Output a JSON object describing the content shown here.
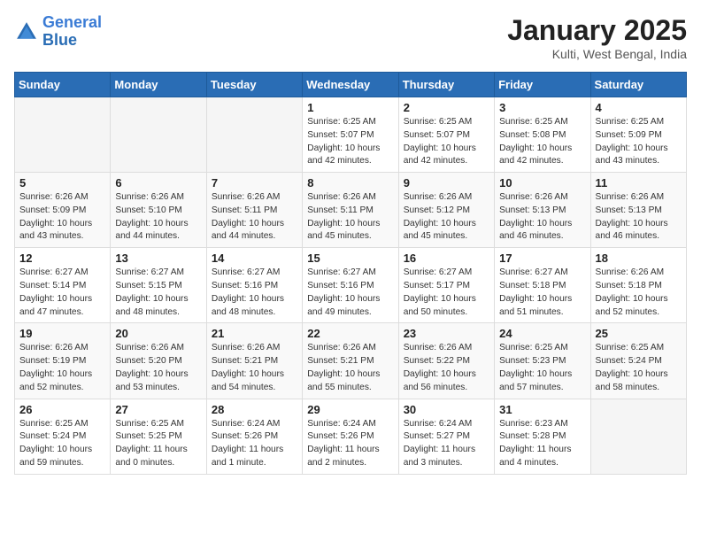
{
  "logo": {
    "line1": "General",
    "line2": "Blue"
  },
  "header": {
    "month": "January 2025",
    "location": "Kulti, West Bengal, India"
  },
  "weekdays": [
    "Sunday",
    "Monday",
    "Tuesday",
    "Wednesday",
    "Thursday",
    "Friday",
    "Saturday"
  ],
  "weeks": [
    [
      {
        "day": "",
        "detail": ""
      },
      {
        "day": "",
        "detail": ""
      },
      {
        "day": "",
        "detail": ""
      },
      {
        "day": "1",
        "detail": "Sunrise: 6:25 AM\nSunset: 5:07 PM\nDaylight: 10 hours\nand 42 minutes."
      },
      {
        "day": "2",
        "detail": "Sunrise: 6:25 AM\nSunset: 5:07 PM\nDaylight: 10 hours\nand 42 minutes."
      },
      {
        "day": "3",
        "detail": "Sunrise: 6:25 AM\nSunset: 5:08 PM\nDaylight: 10 hours\nand 42 minutes."
      },
      {
        "day": "4",
        "detail": "Sunrise: 6:25 AM\nSunset: 5:09 PM\nDaylight: 10 hours\nand 43 minutes."
      }
    ],
    [
      {
        "day": "5",
        "detail": "Sunrise: 6:26 AM\nSunset: 5:09 PM\nDaylight: 10 hours\nand 43 minutes."
      },
      {
        "day": "6",
        "detail": "Sunrise: 6:26 AM\nSunset: 5:10 PM\nDaylight: 10 hours\nand 44 minutes."
      },
      {
        "day": "7",
        "detail": "Sunrise: 6:26 AM\nSunset: 5:11 PM\nDaylight: 10 hours\nand 44 minutes."
      },
      {
        "day": "8",
        "detail": "Sunrise: 6:26 AM\nSunset: 5:11 PM\nDaylight: 10 hours\nand 45 minutes."
      },
      {
        "day": "9",
        "detail": "Sunrise: 6:26 AM\nSunset: 5:12 PM\nDaylight: 10 hours\nand 45 minutes."
      },
      {
        "day": "10",
        "detail": "Sunrise: 6:26 AM\nSunset: 5:13 PM\nDaylight: 10 hours\nand 46 minutes."
      },
      {
        "day": "11",
        "detail": "Sunrise: 6:26 AM\nSunset: 5:13 PM\nDaylight: 10 hours\nand 46 minutes."
      }
    ],
    [
      {
        "day": "12",
        "detail": "Sunrise: 6:27 AM\nSunset: 5:14 PM\nDaylight: 10 hours\nand 47 minutes."
      },
      {
        "day": "13",
        "detail": "Sunrise: 6:27 AM\nSunset: 5:15 PM\nDaylight: 10 hours\nand 48 minutes."
      },
      {
        "day": "14",
        "detail": "Sunrise: 6:27 AM\nSunset: 5:16 PM\nDaylight: 10 hours\nand 48 minutes."
      },
      {
        "day": "15",
        "detail": "Sunrise: 6:27 AM\nSunset: 5:16 PM\nDaylight: 10 hours\nand 49 minutes."
      },
      {
        "day": "16",
        "detail": "Sunrise: 6:27 AM\nSunset: 5:17 PM\nDaylight: 10 hours\nand 50 minutes."
      },
      {
        "day": "17",
        "detail": "Sunrise: 6:27 AM\nSunset: 5:18 PM\nDaylight: 10 hours\nand 51 minutes."
      },
      {
        "day": "18",
        "detail": "Sunrise: 6:26 AM\nSunset: 5:18 PM\nDaylight: 10 hours\nand 52 minutes."
      }
    ],
    [
      {
        "day": "19",
        "detail": "Sunrise: 6:26 AM\nSunset: 5:19 PM\nDaylight: 10 hours\nand 52 minutes."
      },
      {
        "day": "20",
        "detail": "Sunrise: 6:26 AM\nSunset: 5:20 PM\nDaylight: 10 hours\nand 53 minutes."
      },
      {
        "day": "21",
        "detail": "Sunrise: 6:26 AM\nSunset: 5:21 PM\nDaylight: 10 hours\nand 54 minutes."
      },
      {
        "day": "22",
        "detail": "Sunrise: 6:26 AM\nSunset: 5:21 PM\nDaylight: 10 hours\nand 55 minutes."
      },
      {
        "day": "23",
        "detail": "Sunrise: 6:26 AM\nSunset: 5:22 PM\nDaylight: 10 hours\nand 56 minutes."
      },
      {
        "day": "24",
        "detail": "Sunrise: 6:25 AM\nSunset: 5:23 PM\nDaylight: 10 hours\nand 57 minutes."
      },
      {
        "day": "25",
        "detail": "Sunrise: 6:25 AM\nSunset: 5:24 PM\nDaylight: 10 hours\nand 58 minutes."
      }
    ],
    [
      {
        "day": "26",
        "detail": "Sunrise: 6:25 AM\nSunset: 5:24 PM\nDaylight: 10 hours\nand 59 minutes."
      },
      {
        "day": "27",
        "detail": "Sunrise: 6:25 AM\nSunset: 5:25 PM\nDaylight: 11 hours\nand 0 minutes."
      },
      {
        "day": "28",
        "detail": "Sunrise: 6:24 AM\nSunset: 5:26 PM\nDaylight: 11 hours\nand 1 minute."
      },
      {
        "day": "29",
        "detail": "Sunrise: 6:24 AM\nSunset: 5:26 PM\nDaylight: 11 hours\nand 2 minutes."
      },
      {
        "day": "30",
        "detail": "Sunrise: 6:24 AM\nSunset: 5:27 PM\nDaylight: 11 hours\nand 3 minutes."
      },
      {
        "day": "31",
        "detail": "Sunrise: 6:23 AM\nSunset: 5:28 PM\nDaylight: 11 hours\nand 4 minutes."
      },
      {
        "day": "",
        "detail": ""
      }
    ]
  ]
}
